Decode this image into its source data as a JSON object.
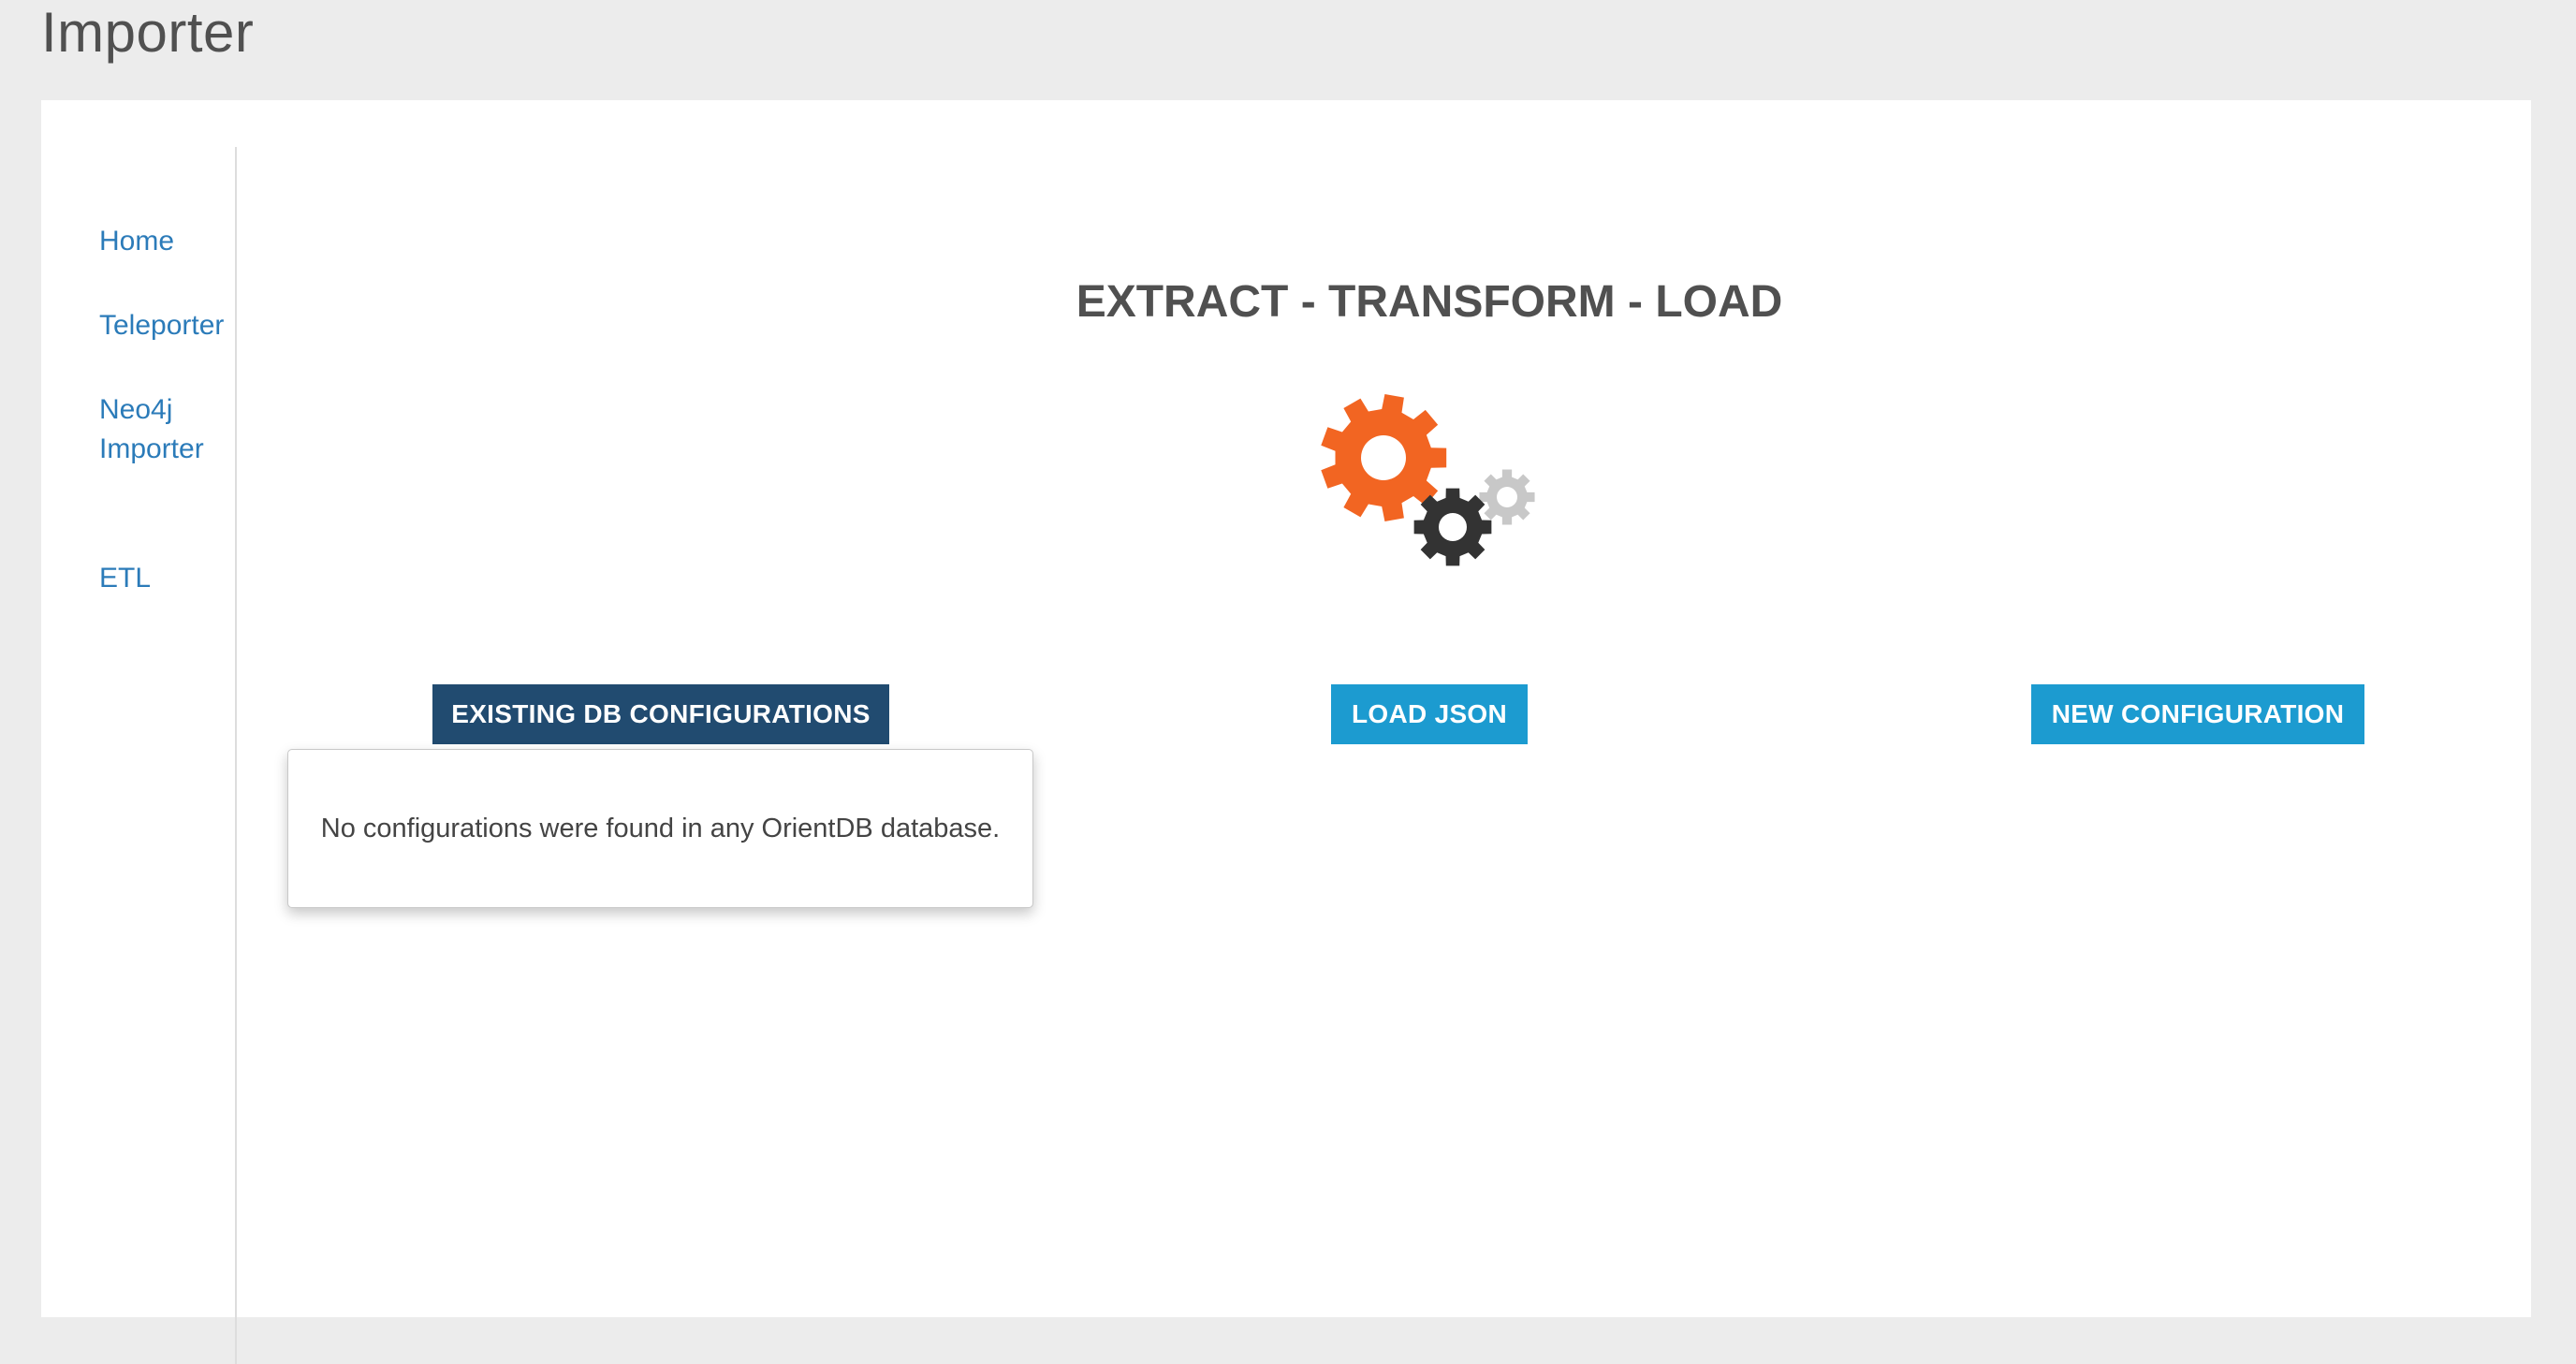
{
  "header": {
    "title": "Importer"
  },
  "sidebar": {
    "items": [
      {
        "label": "Home"
      },
      {
        "label": "Teleporter"
      },
      {
        "label": "Neo4j Importer"
      },
      {
        "label": "ETL"
      }
    ]
  },
  "main": {
    "heading": "EXTRACT - TRANSFORM - LOAD",
    "icon": "gears-icon",
    "buttons": {
      "existing_label": "EXISTING DB CONFIGURATIONS",
      "load_label": "LOAD JSON",
      "new_label": "NEW CONFIGURATION"
    },
    "popover": {
      "message": "No configurations were found in any OrientDB database."
    }
  },
  "colors": {
    "background": "#ececec",
    "link": "#2b7bb9",
    "primary_dark": "#214b70",
    "primary": "#1c9bd0",
    "gear_orange": "#f26522",
    "gear_dark": "#333333",
    "gear_light": "#c8c8c8"
  }
}
